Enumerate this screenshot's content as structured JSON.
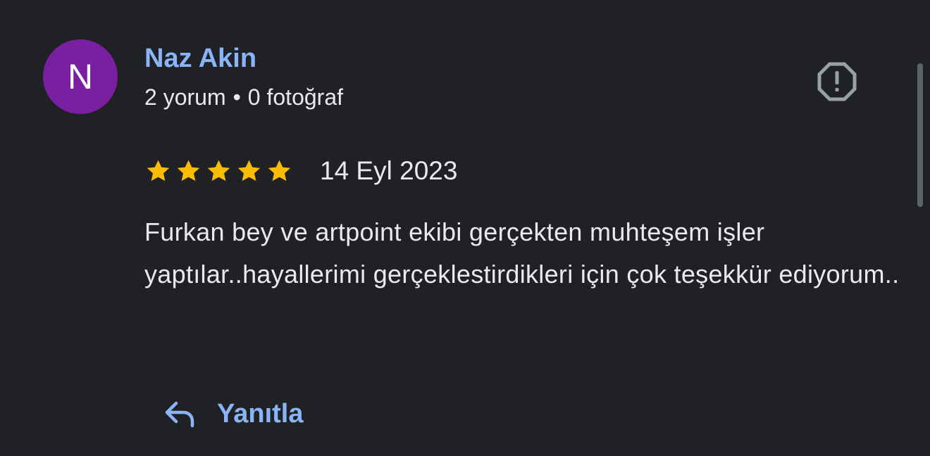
{
  "reviewer": {
    "initial": "N",
    "name": "Naz Akin",
    "review_count": "2 yorum",
    "separator": "•",
    "photo_count": "0 fotoğraf",
    "avatar_color": "#7b1fa2"
  },
  "review": {
    "rating": 5,
    "max_rating": 5,
    "date": "14 Eyl 2023",
    "text": "Furkan bey ve artpoint ekibi gerçekten muhteşem işler yaptılar..hayallerimi gerçeklestirdikleri için çok teşekkür ediyorum.."
  },
  "actions": {
    "report_icon": "report-flag-icon",
    "reply_icon": "reply-arrow-icon",
    "reply_label": "Yanıtla"
  },
  "colors": {
    "background": "#202124",
    "accent": "#8ab4f8",
    "star": "#fbbc04",
    "text": "#e8eaed",
    "icon": "#9aa0a6"
  }
}
